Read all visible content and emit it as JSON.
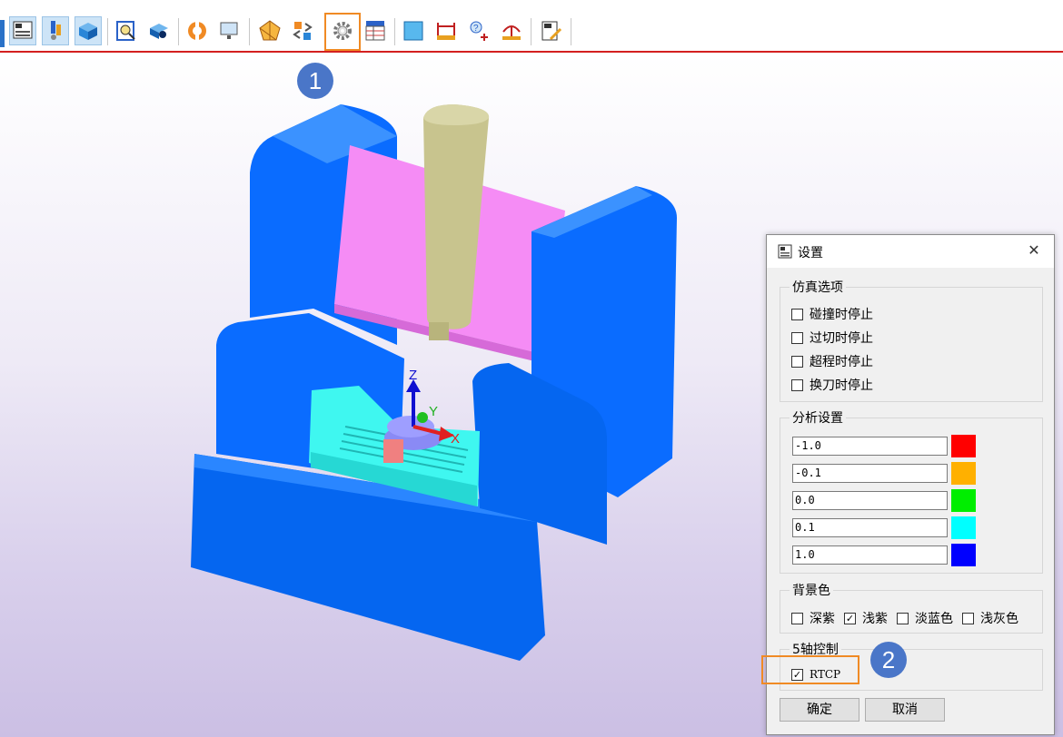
{
  "toolbar": {
    "buttons": [
      {
        "icon": "machine-panel-icon"
      },
      {
        "icon": "tool-edit-icon"
      },
      {
        "icon": "stock-box-icon"
      },
      {
        "icon": "magnifier-doc-icon"
      },
      {
        "icon": "camera-inspect-icon"
      },
      {
        "icon": "lifebuoy-icon"
      },
      {
        "icon": "monitor-icon"
      },
      {
        "icon": "polygon-icon"
      },
      {
        "icon": "transform-icon"
      },
      {
        "icon": "gear-icon"
      },
      {
        "icon": "register-table-icon"
      },
      {
        "icon": "plane-icon"
      },
      {
        "icon": "measure-distance-icon"
      },
      {
        "icon": "probe-add-icon"
      },
      {
        "icon": "measure-arc-icon"
      },
      {
        "icon": "report-pen-icon"
      }
    ],
    "callout_1": "1"
  },
  "viewport": {
    "axes": {
      "z": "Z",
      "y": "Y",
      "x": "X"
    },
    "colors": {
      "frame": "#0a6cff",
      "crossbeam": "#f58cf5",
      "spindle": "#c8c48e",
      "table": "#3ff7f0",
      "part": "#8a8af5"
    }
  },
  "dialog": {
    "title": "设置",
    "close_label": "✕",
    "sim_group": {
      "label": "仿真选项",
      "options": [
        {
          "label": "碰撞时停止",
          "checked": false
        },
        {
          "label": "过切时停止",
          "checked": false
        },
        {
          "label": "超程时停止",
          "checked": false
        },
        {
          "label": "换刀时停止",
          "checked": false
        }
      ]
    },
    "analysis_group": {
      "label": "分析设置",
      "rows": [
        {
          "value": "-1.0",
          "color": "#ff0000"
        },
        {
          "value": "-0.1",
          "color": "#ffb000"
        },
        {
          "value": "0.0",
          "color": "#00ee00"
        },
        {
          "value": "0.1",
          "color": "#00ffff"
        },
        {
          "value": "1.0",
          "color": "#0000ff"
        }
      ]
    },
    "bg_group": {
      "label": "背景色",
      "options": [
        {
          "label": "深紫",
          "checked": false
        },
        {
          "label": "浅紫",
          "checked": true
        },
        {
          "label": "淡蓝色",
          "checked": false
        },
        {
          "label": "浅灰色",
          "checked": false
        }
      ]
    },
    "axis5_group": {
      "label": "5轴控制",
      "rtcp_label": "RTCP",
      "rtcp_checked": true
    },
    "ok_label": "确定",
    "cancel_label": "取消",
    "callout_2": "2"
  }
}
